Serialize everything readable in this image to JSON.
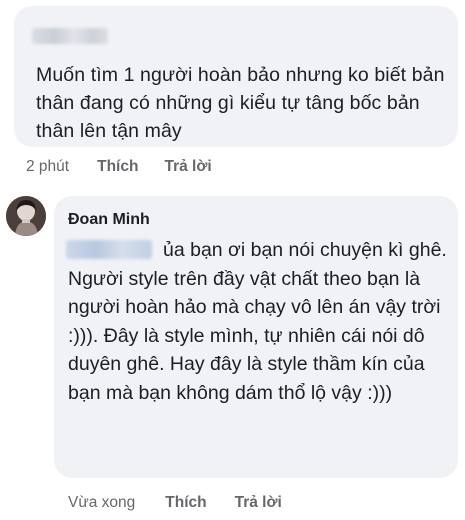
{
  "comment_top": {
    "text": "Muốn tìm 1 người hoàn bảo nhưng ko biết bản thân đang có những gì kiểu tự tâng bốc bản thân lên tận mây",
    "time": "2 phút",
    "like_label": "Thích",
    "reply_label": "Trả lời"
  },
  "comment_reply": {
    "author": "Đoan Minh",
    "text": "ủa bạn ơi bạn nói chuyện kì ghê. Người style trên đầy vật chất theo bạn là người hoàn hảo mà chạy vô lên án vậy trời :))). Đây là style mình, tự nhiên cái nói dô duyên ghê. Hay đây là style thầm kín của bạn mà bạn không dám thổ lộ vậy :)))",
    "time": "Vừa xong",
    "like_label": "Thích",
    "reply_label": "Trả lời"
  }
}
